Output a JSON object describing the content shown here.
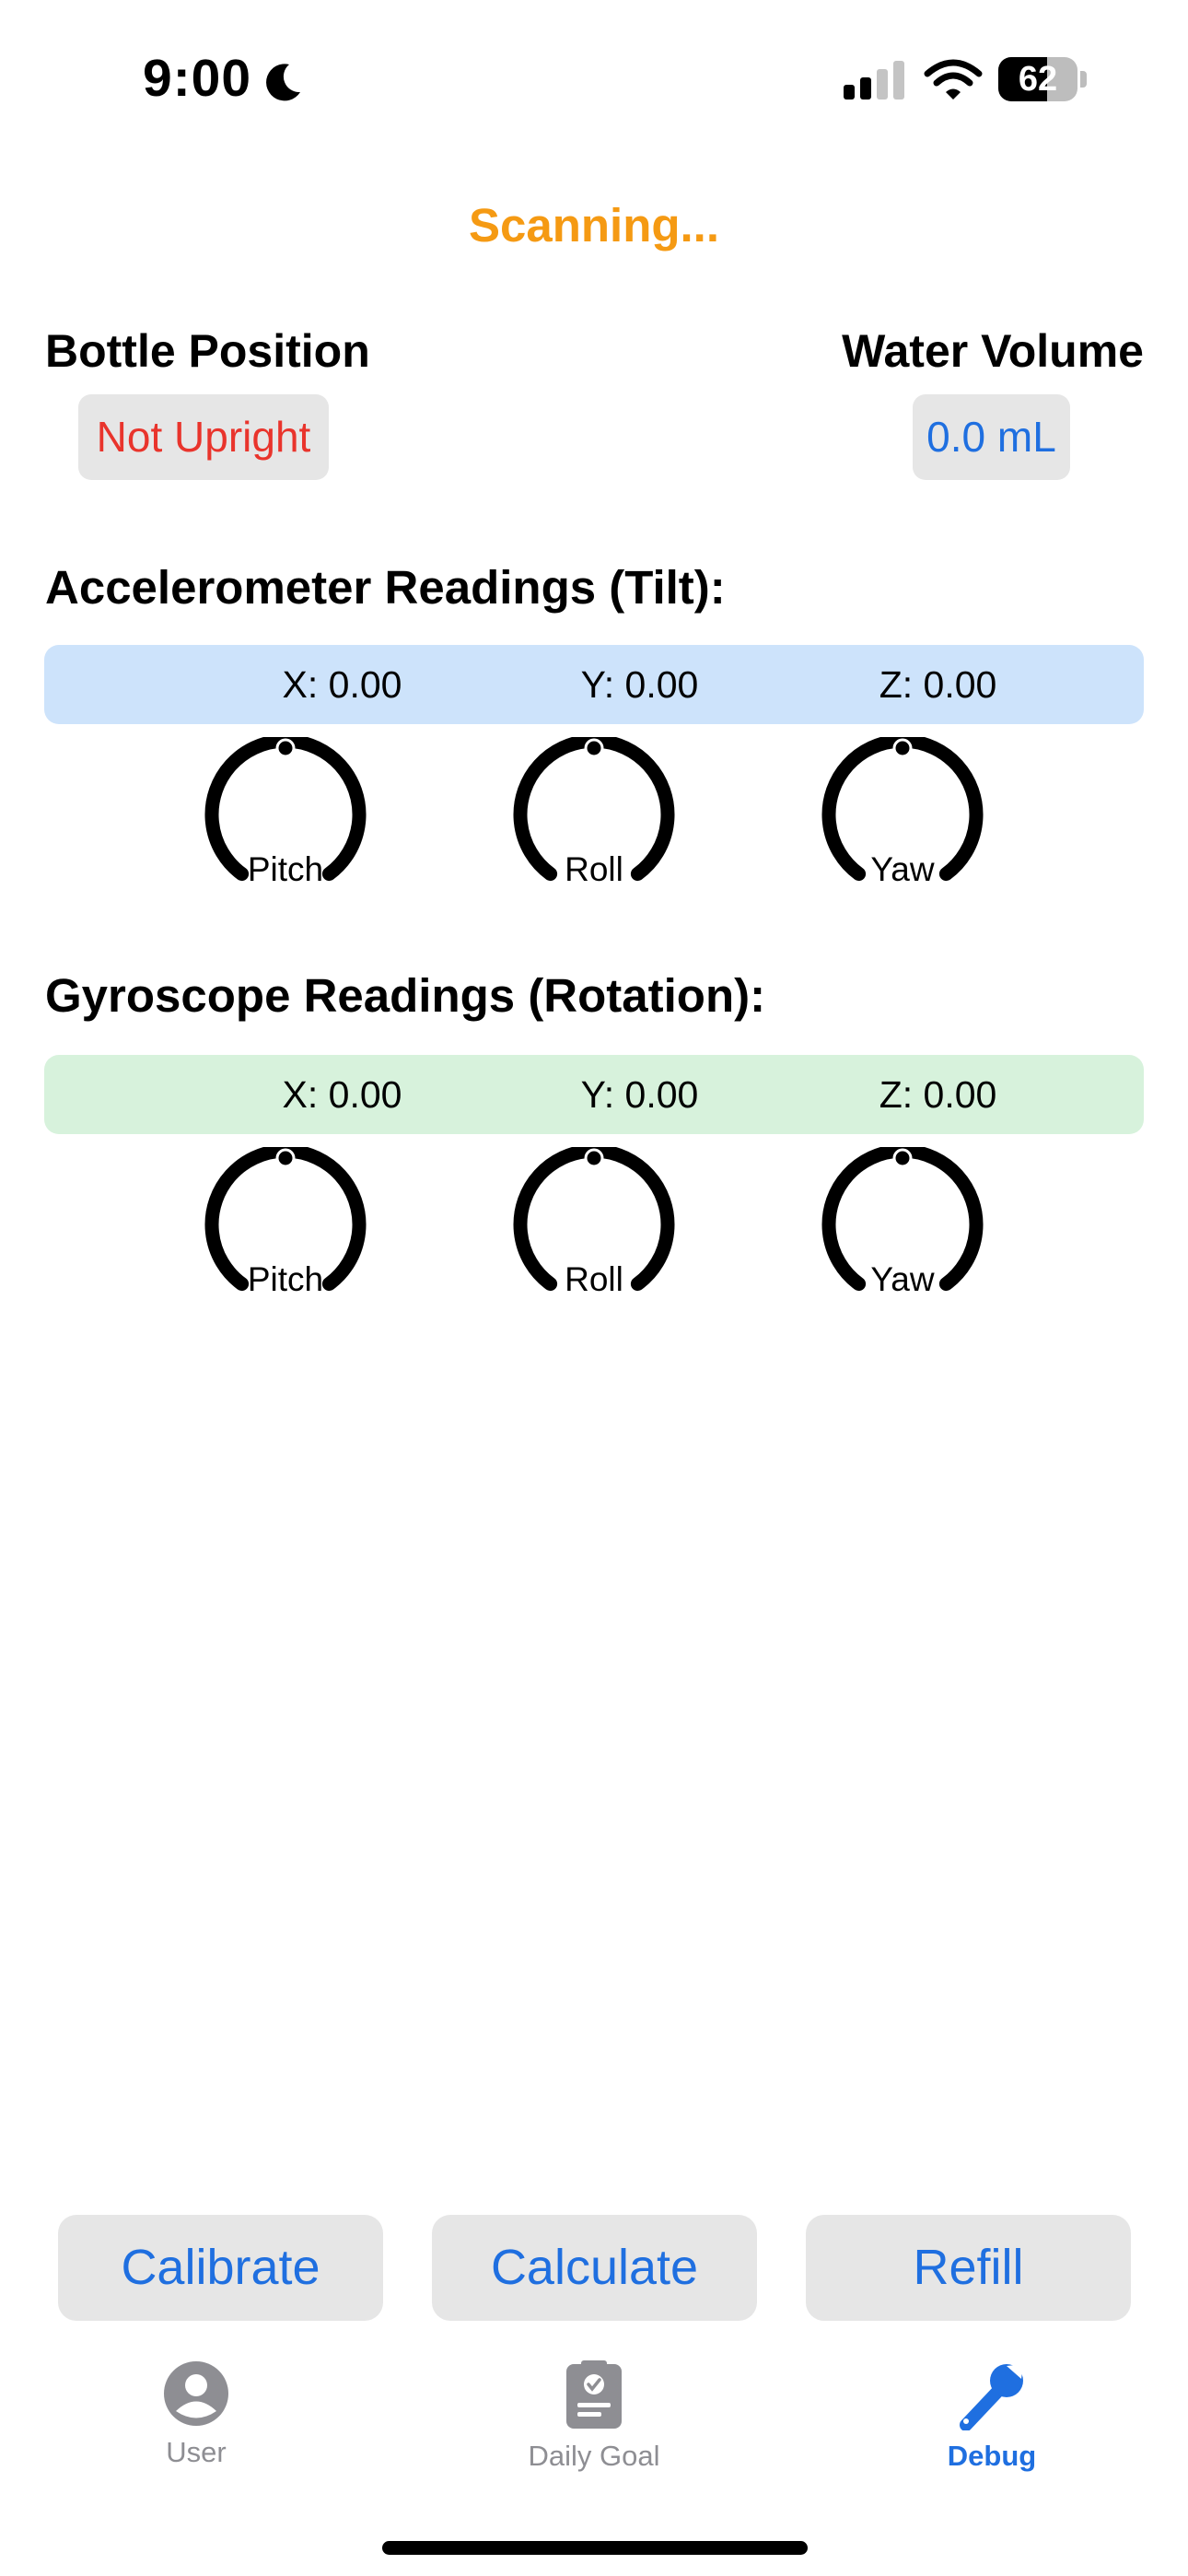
{
  "status_bar": {
    "time": "9:00",
    "battery_level": "62",
    "battery_fraction": 0.62,
    "icons": [
      "moon-icon",
      "cellular-signal-icon",
      "wifi-icon",
      "battery-icon"
    ]
  },
  "header": {
    "status": "Scanning..."
  },
  "bottle": {
    "title": "Bottle Position",
    "value": "Not Upright"
  },
  "volume": {
    "title": "Water Volume",
    "value": "0.0 mL"
  },
  "accelerometer": {
    "title": "Accelerometer Readings (Tilt):",
    "x": "X: 0.00",
    "y": "Y: 0.00",
    "z": "Z: 0.00",
    "gauges": [
      "Pitch",
      "Roll",
      "Yaw"
    ]
  },
  "gyroscope": {
    "title": "Gyroscope Readings (Rotation):",
    "x": "X: 0.00",
    "y": "Y: 0.00",
    "z": "Z: 0.00",
    "gauges": [
      "Pitch",
      "Roll",
      "Yaw"
    ]
  },
  "actions": {
    "calibrate": "Calibrate",
    "calculate": "Calculate",
    "refill": "Refill"
  },
  "tabs": [
    {
      "label": "User",
      "icon": "person-circle-icon",
      "active": false
    },
    {
      "label": "Daily Goal",
      "icon": "clipboard-check-icon",
      "active": false
    },
    {
      "label": "Debug",
      "icon": "wrench-icon",
      "active": true
    }
  ],
  "colors": {
    "accent": "#1f6fe0",
    "scanning": "#f59a13",
    "warning": "#e9342c",
    "accelerometer_bg": "#cde3fb",
    "gyroscope_bg": "#d7f2dc"
  }
}
